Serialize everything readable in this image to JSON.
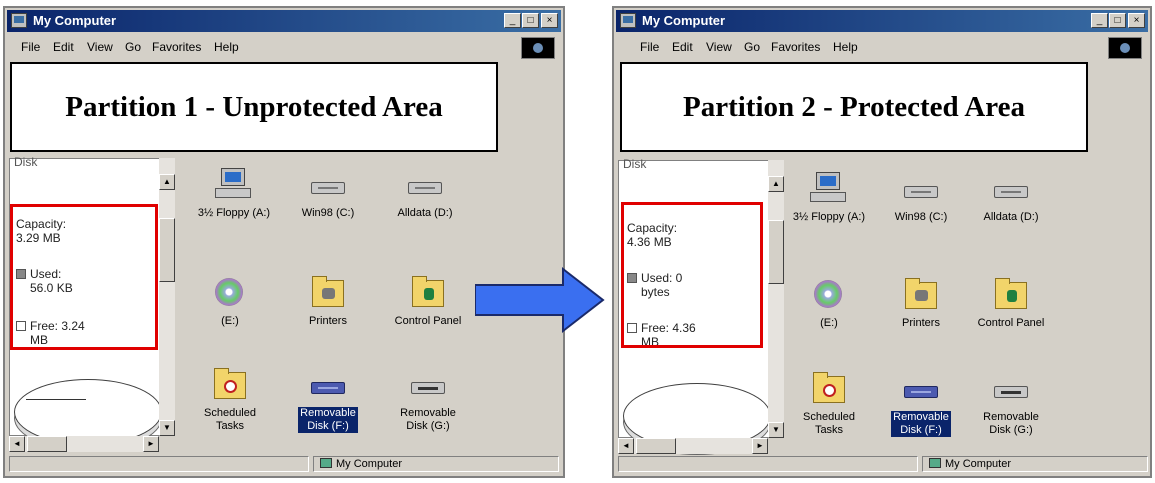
{
  "menu": [
    "File",
    "Edit",
    "View",
    "Go",
    "Favorites",
    "Help"
  ],
  "left_window": {
    "title": "My Computer",
    "overlay_label": "Partition 1 - Unprotected Area",
    "pane_cut_text": "Disk",
    "capacity": "Capacity:\n3.29 MB",
    "used": "Used:\n56.0 KB",
    "free": "Free: 3.24\nMB",
    "status": "My Computer"
  },
  "right_window": {
    "title": "My Computer",
    "overlay_label": "Partition 2 - Protected Area",
    "pane_cut_text": "Disk",
    "capacity": "Capacity:\n4.36 MB",
    "used": "Used: 0\nbytes",
    "free": "Free: 4.36\nMB",
    "status": "My Computer"
  },
  "icons": [
    {
      "label": "3½ Floppy (A:)",
      "kind": "computer-icon"
    },
    {
      "label": "Win98 (C:)",
      "kind": "hard-drive-icon"
    },
    {
      "label": "Alldata (D:)",
      "kind": "hard-drive-icon"
    },
    {
      "label": "(E:)",
      "kind": "cd-drive-icon"
    },
    {
      "label": "Printers",
      "kind": "printers-folder-icon"
    },
    {
      "label": "Control Panel",
      "kind": "control-panel-folder-icon"
    },
    {
      "label": "Scheduled\nTasks",
      "kind": "scheduled-tasks-folder-icon"
    },
    {
      "label": "Removable\nDisk (F:)",
      "kind": "removable-disk-icon",
      "selected": true
    },
    {
      "label": "Removable\nDisk (G:)",
      "kind": "removable-disk-icon"
    }
  ],
  "colors": {
    "highlight_box": "#e00000",
    "arrow": "#3a6ff0",
    "titlebar": "#0a246a",
    "selection": "#0a246a"
  }
}
